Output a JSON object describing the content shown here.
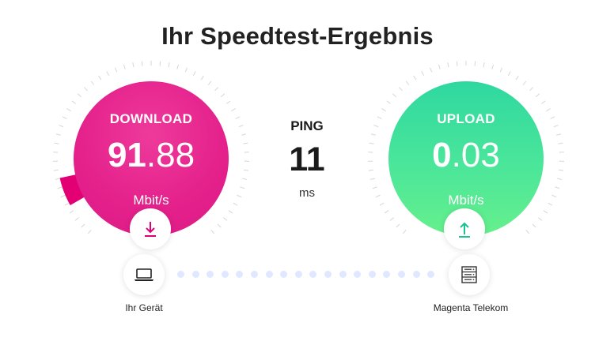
{
  "title": "Ihr Speedtest-Ergebnis",
  "download": {
    "label": "DOWNLOAD",
    "value_int": "91",
    "value_dec": ".88",
    "unit": "Mbit/s",
    "color": "#e4208b",
    "icon": "arrow-down-icon"
  },
  "ping": {
    "label": "PING",
    "value": "11",
    "unit": "ms"
  },
  "upload": {
    "label": "UPLOAD",
    "value_int": "0",
    "value_dec": ".03",
    "unit": "Mbit/s",
    "color": "#3de29c",
    "icon": "arrow-up-icon"
  },
  "device": {
    "caption": "Ihr Gerät",
    "icon": "laptop-icon"
  },
  "server": {
    "caption": "Magenta Telekom",
    "icon": "server-icon"
  },
  "colors": {
    "accent": "#e20074",
    "dots": "#dfe8ff",
    "tick": "#d6d6d6"
  }
}
